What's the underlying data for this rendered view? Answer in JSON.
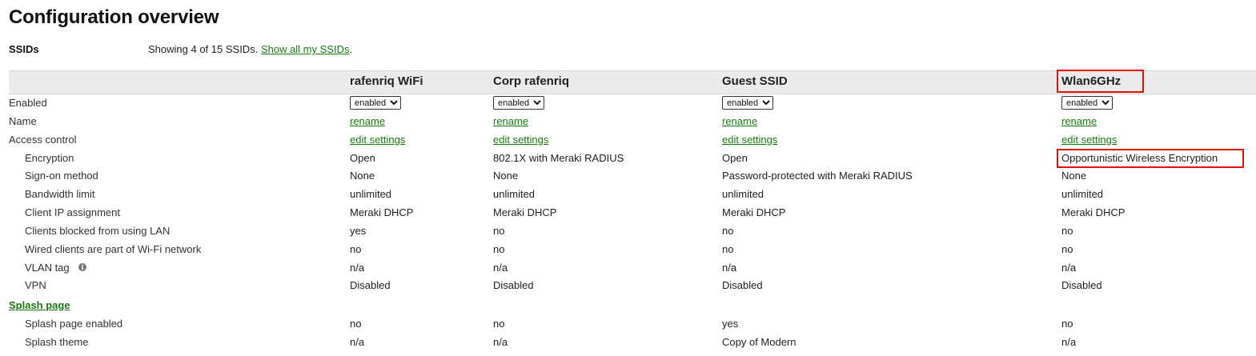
{
  "page": {
    "title": "Configuration overview"
  },
  "ssids": {
    "label": "SSIDs",
    "showing_text": "Showing 4 of 15 SSIDs.",
    "show_all_link": "Show all my SSIDs",
    "showing_suffix": "."
  },
  "columns": [
    {
      "name": "rafenriq WiFi",
      "enabled": "enabled",
      "rename": "rename",
      "access_control": "edit settings",
      "encryption": "Open",
      "sign_on": "None",
      "bandwidth": "unlimited",
      "client_ip": "Meraki DHCP",
      "clients_blocked": "yes",
      "wired_clients": "no",
      "vlan_tag": "n/a",
      "vpn": "Disabled",
      "splash_enabled": "no",
      "splash_theme": "n/a"
    },
    {
      "name": "Corp rafenriq",
      "enabled": "enabled",
      "rename": "rename",
      "access_control": "edit settings",
      "encryption": "802.1X with Meraki RADIUS",
      "sign_on": "None",
      "bandwidth": "unlimited",
      "client_ip": "Meraki DHCP",
      "clients_blocked": "no",
      "wired_clients": "no",
      "vlan_tag": "n/a",
      "vpn": "Disabled",
      "splash_enabled": "no",
      "splash_theme": "n/a"
    },
    {
      "name": "Guest SSID",
      "enabled": "enabled",
      "rename": "rename",
      "access_control": "edit settings",
      "encryption": "Open",
      "sign_on": "Password-protected with Meraki RADIUS",
      "bandwidth": "unlimited",
      "client_ip": "Meraki DHCP",
      "clients_blocked": "no",
      "wired_clients": "no",
      "vlan_tag": "n/a",
      "vpn": "Disabled",
      "splash_enabled": "yes",
      "splash_theme": "Copy of Modern"
    },
    {
      "name": "Wlan6GHz",
      "enabled": "enabled",
      "rename": "rename",
      "access_control": "edit settings",
      "encryption": "Opportunistic Wireless Encryption",
      "sign_on": "None",
      "bandwidth": "unlimited",
      "client_ip": "Meraki DHCP",
      "clients_blocked": "no",
      "wired_clients": "no",
      "vlan_tag": "n/a",
      "vpn": "Disabled",
      "splash_enabled": "no",
      "splash_theme": "n/a"
    }
  ],
  "row_labels": {
    "enabled": "Enabled",
    "name": "Name",
    "access_control": "Access control",
    "encryption": "Encryption",
    "sign_on": "Sign-on method",
    "bandwidth": "Bandwidth limit",
    "client_ip": "Client IP assignment",
    "clients_blocked": "Clients blocked from using LAN",
    "wired_clients": "Wired clients are part of Wi-Fi network",
    "vlan_tag": "VLAN tag",
    "vpn": "VPN",
    "splash_page": "Splash page",
    "splash_enabled": "Splash page enabled",
    "splash_theme": "Splash theme"
  },
  "icons": {
    "vlan_info": "info-icon"
  },
  "colors": {
    "link": "#1a7a12",
    "highlight": "#e01010",
    "header_band": "#ebebeb"
  }
}
